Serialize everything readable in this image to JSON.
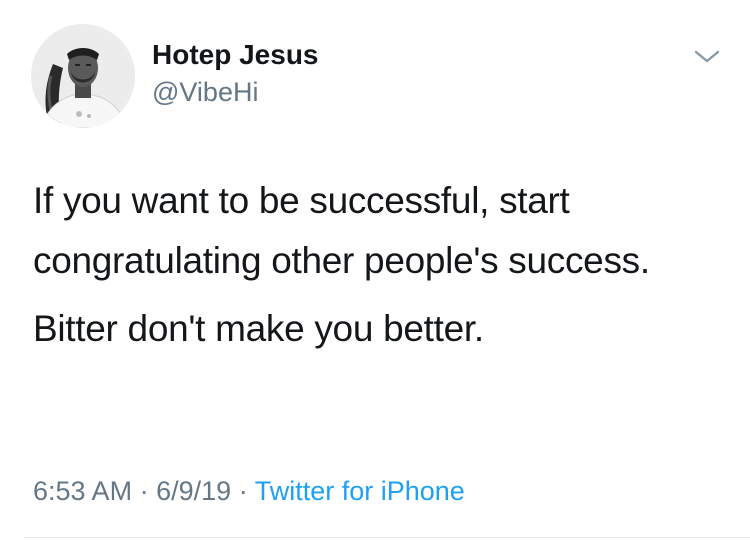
{
  "user": {
    "display_name": "Hotep Jesus",
    "handle": "@VibeHi",
    "avatar_icon": "profile-photo"
  },
  "tweet": {
    "paragraphs": [
      "If you want to be successful, start congratulating other people's success.",
      "Bitter don't make you better."
    ],
    "time": "6:53 AM",
    "separator": "·",
    "date": "6/9/19",
    "source": "Twitter for iPhone"
  },
  "menu": {
    "icon": "chevron-down-icon"
  },
  "colors": {
    "text": "#14171a",
    "secondary": "#657786",
    "link": "#1da1f2",
    "divider": "#e1e8ed"
  }
}
